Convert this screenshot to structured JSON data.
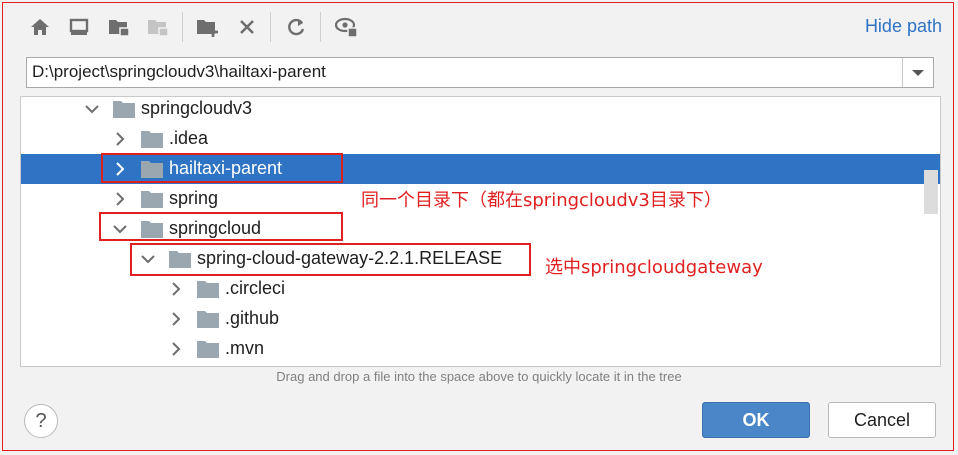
{
  "toolbar": {
    "icons": [
      "home-icon",
      "desktop-icon",
      "project-folder-icon",
      "module-folder-icon",
      "new-folder-icon",
      "delete-icon",
      "refresh-icon",
      "show-hidden-icon"
    ],
    "hide_path_label": "Hide path"
  },
  "path": {
    "value": "D:\\project\\springcloudv3\\hailtaxi-parent"
  },
  "tree": {
    "items": [
      {
        "label": "springcloudv3",
        "expanded": true,
        "selected": false
      },
      {
        "label": ".idea",
        "expanded": false,
        "selected": false
      },
      {
        "label": "hailtaxi-parent",
        "expanded": false,
        "selected": true
      },
      {
        "label": "spring",
        "expanded": false,
        "selected": false
      },
      {
        "label": "springcloud",
        "expanded": true,
        "selected": false
      },
      {
        "label": "spring-cloud-gateway-2.2.1.RELEASE",
        "expanded": true,
        "selected": false
      },
      {
        "label": ".circleci",
        "expanded": false,
        "selected": false
      },
      {
        "label": ".github",
        "expanded": false,
        "selected": false
      },
      {
        "label": ".mvn",
        "expanded": false,
        "selected": false
      }
    ]
  },
  "hint": "Drag and drop a file into the space above to quickly locate it in the tree",
  "buttons": {
    "help": "?",
    "ok": "OK",
    "cancel": "Cancel"
  },
  "annotations": {
    "same_dir": "同一个目录下（都在springcloudv3目录下）",
    "select_gateway": "选中springcloudgateway"
  },
  "colors": {
    "selection": "#2f73c5",
    "annotation": "#e02020",
    "link": "#2f73c5",
    "ok": "#4a86c8"
  }
}
